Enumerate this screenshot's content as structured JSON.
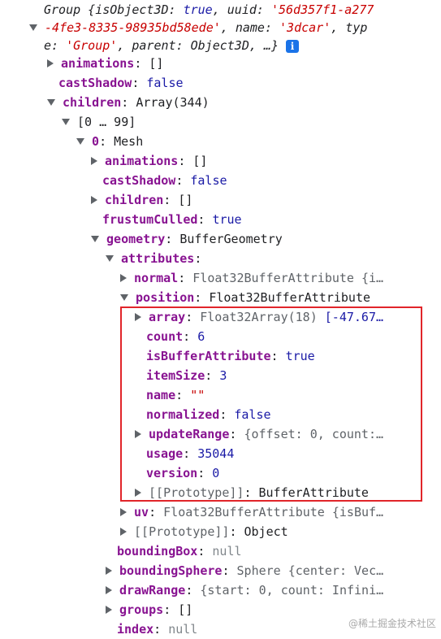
{
  "header": {
    "line1_a": "Group {",
    "line1_k1": "isObject3D",
    "line1_v1": "true",
    "line1_k2": "uuid",
    "line1_v2_part1": "'56d357f1-a277",
    "line2_v2_part2": "-4fe3-8335-98935bd58ede'",
    "line2_k3": "name",
    "line2_v3": "'3dcar'",
    "line2_k4_part1": "typ",
    "line3_k4_part2": "e",
    "line3_v4": "'Group'",
    "line3_k5": "parent",
    "line3_v5": "Object3D, …}",
    "info_glyph": "i"
  },
  "tree": {
    "animations_key": "animations",
    "animations_val": "[]",
    "castShadow_key": "castShadow",
    "castShadow_val": "false",
    "children_key": "children",
    "children_val": "Array(344)",
    "range": "[0 … 99]",
    "mesh_key": "0",
    "mesh_val": "Mesh",
    "m_animations_key": "animations",
    "m_animations_val": "[]",
    "m_castShadow_key": "castShadow",
    "m_castShadow_val": "false",
    "m_children_key": "children",
    "m_children_val": "[]",
    "m_frustum_key": "frustumCulled",
    "m_frustum_val": "true",
    "m_geometry_key": "geometry",
    "m_geometry_val": "BufferGeometry",
    "g_attributes_key": "attributes",
    "a_normal_key": "normal",
    "a_normal_val": "Float32BufferAttribute {i…",
    "a_position_key": "position",
    "a_position_val": "Float32BufferAttribute",
    "p_array_key": "array",
    "p_array_val": "Float32Array(18)",
    "p_array_preview": "[-47.67…",
    "p_count_key": "count",
    "p_count_val": "6",
    "p_isba_key": "isBufferAttribute",
    "p_isba_val": "true",
    "p_itemSize_key": "itemSize",
    "p_itemSize_val": "3",
    "p_name_key": "name",
    "p_name_val": "\"\"",
    "p_normalized_key": "normalized",
    "p_normalized_val": "false",
    "p_updateRange_key": "updateRange",
    "p_updateRange_val": "{offset: 0, count:…",
    "p_usage_key": "usage",
    "p_usage_val": "35044",
    "p_version_key": "version",
    "p_version_val": "0",
    "p_proto_key": "[[Prototype]]",
    "p_proto_val": "BufferAttribute",
    "a_uv_key": "uv",
    "a_uv_val": "Float32BufferAttribute {isBuf…",
    "a_proto_key": "[[Prototype]]",
    "a_proto_val": "Object",
    "g_boundingBox_key": "boundingBox",
    "g_boundingBox_val": "null",
    "g_boundingSphere_key": "boundingSphere",
    "g_boundingSphere_val": "Sphere {center: Vec…",
    "g_drawRange_key": "drawRange",
    "g_drawRange_val": "{start: 0, count: Infini…",
    "g_groups_key": "groups",
    "g_groups_val": "[]",
    "g_index_key": "index",
    "g_index_val": "null"
  },
  "watermark": "@稀土掘金技术社区",
  "colors": {
    "key": "#881391",
    "boolean_number": "#1a1aa6",
    "string": "#c80000",
    "highlight_box": "#e1252a",
    "info_badge": "#1a73e8"
  }
}
